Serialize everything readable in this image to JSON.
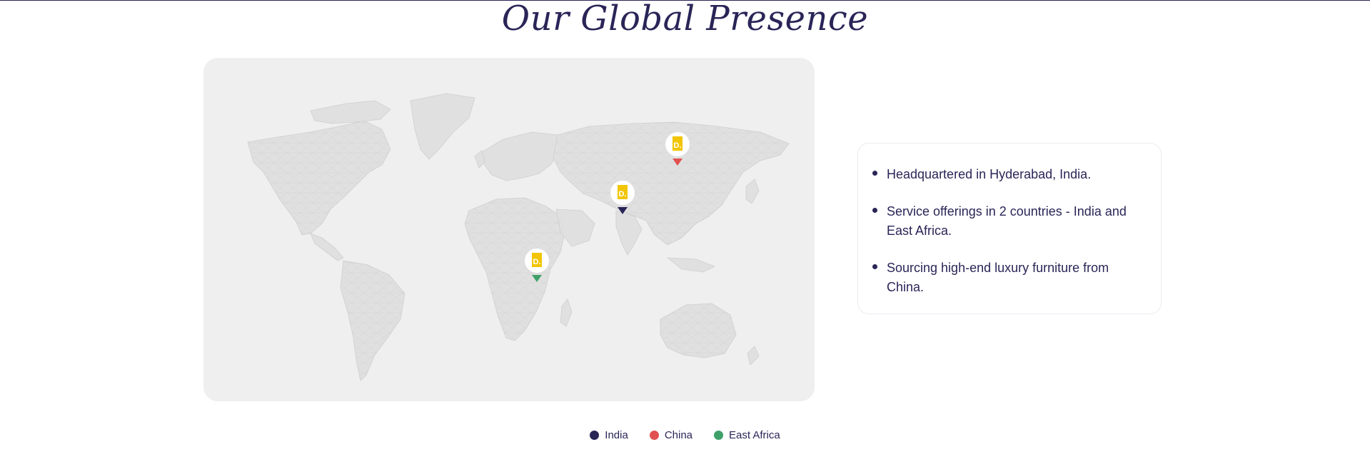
{
  "page": {
    "title": "Our Global Presence"
  },
  "map": {
    "markers": [
      {
        "region": "China",
        "logo_text": "D.",
        "color": "#e0514f"
      },
      {
        "region": "India",
        "logo_text": "D.",
        "color": "#2a2557"
      },
      {
        "region": "East Africa",
        "logo_text": "D.",
        "color": "#3fa06a"
      }
    ],
    "logo_color": "#f2c500"
  },
  "info": {
    "items": [
      "Headquartered in Hyderabad, India.",
      "Service offerings in 2 countries - India and East Africa.",
      "Sourcing high-end luxury furniture from China."
    ]
  },
  "legend": {
    "items": [
      {
        "label": "India",
        "color": "#2a2557"
      },
      {
        "label": "China",
        "color": "#e0514f"
      },
      {
        "label": "East Africa",
        "color": "#3fa06a"
      }
    ]
  }
}
